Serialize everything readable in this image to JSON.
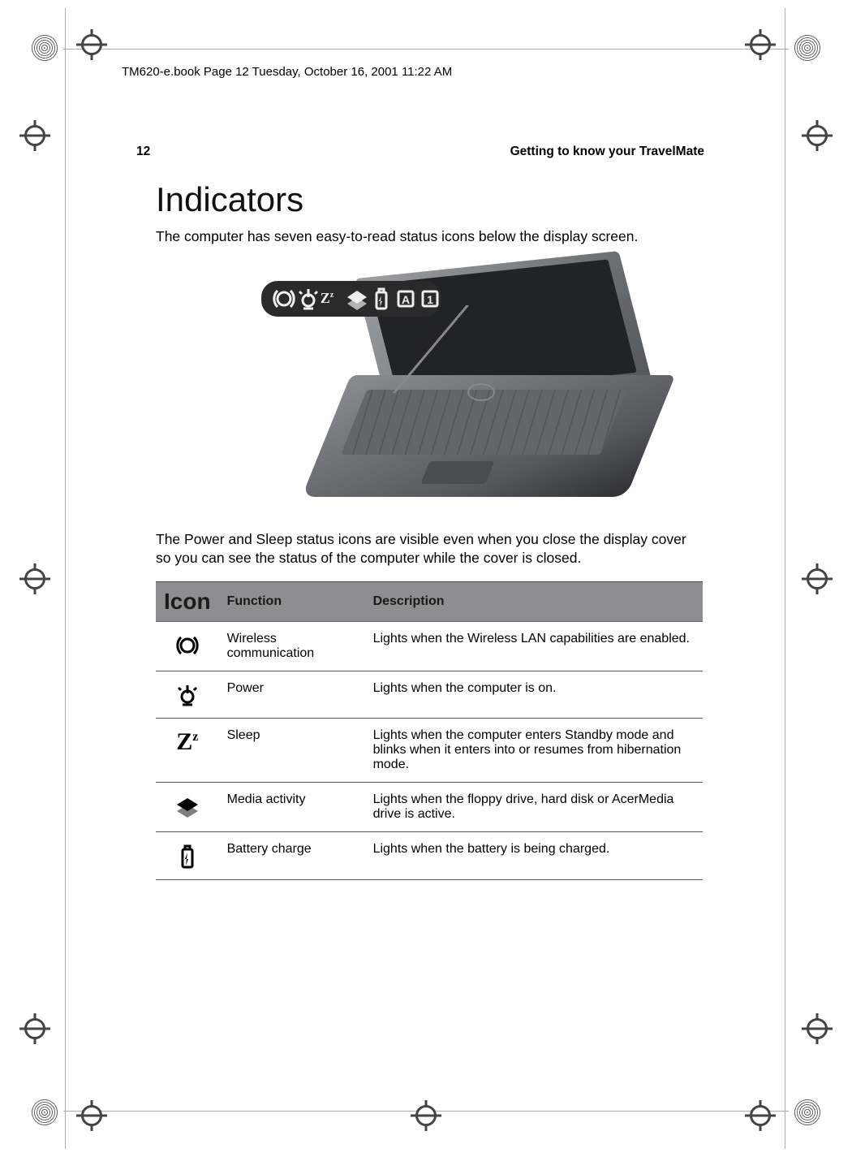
{
  "header_line": "TM620-e.book  Page 12  Tuesday, October 16, 2001  11:22 AM",
  "page_number": "12",
  "chapter_title": "Getting to know your TravelMate",
  "section_title": "Indicators",
  "intro_para": "The computer has seven easy-to-read status icons below the display screen.",
  "mid_para": "The Power and Sleep status icons are visible even when you close the display cover so you can see the status of the computer while the cover is closed.",
  "table": {
    "headers": {
      "icon": "Icon",
      "func": "Function",
      "desc": "Description"
    },
    "rows": [
      {
        "icon_id": "wireless-icon",
        "func": "Wireless communication",
        "desc": "Lights when the Wireless LAN capabilities are enabled."
      },
      {
        "icon_id": "power-icon",
        "func": "Power",
        "desc": "Lights when the computer is on."
      },
      {
        "icon_id": "sleep-icon",
        "func": "Sleep",
        "desc": "Lights when the computer enters Standby mode and blinks when it enters into or resumes from hibernation mode."
      },
      {
        "icon_id": "media-icon",
        "func": "Media activity",
        "desc": "Lights when the floppy drive, hard disk or AcerMedia drive is active."
      },
      {
        "icon_id": "battery-icon",
        "func": "Battery charge",
        "desc": "Lights when the battery is being charged."
      }
    ]
  }
}
